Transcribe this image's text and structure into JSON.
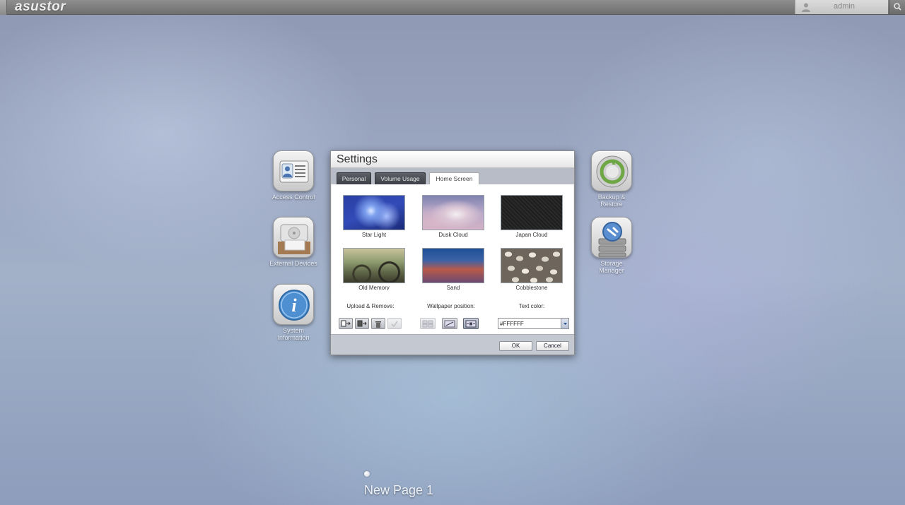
{
  "topbar": {
    "brand": "asustor",
    "username": "admin"
  },
  "desktop": {
    "left_apps": [
      {
        "label": "Access Control"
      },
      {
        "label": "External Devices"
      },
      {
        "label": "System Information"
      }
    ],
    "right_apps": [
      {
        "label": "Backup & Restore"
      },
      {
        "label": "Storage Manager"
      }
    ],
    "page_label": "New Page 1"
  },
  "dialog": {
    "title": "Settings",
    "tabs": [
      {
        "label": "Personal"
      },
      {
        "label": "Volume Usage"
      },
      {
        "label": "Home Screen"
      }
    ],
    "active_tab": "Home Screen",
    "wallpapers": [
      {
        "label": "Star Light"
      },
      {
        "label": "Dusk Cloud"
      },
      {
        "label": "Japan Cloud"
      },
      {
        "label": "Old Memory"
      },
      {
        "label": "Sand"
      },
      {
        "label": "Cobblestone"
      }
    ],
    "options": {
      "upload_label": "Upload & Remove:",
      "position_label": "Wallpaper position:",
      "color_label": "Text color:",
      "text_color_value": "#FFFFFF"
    },
    "buttons": {
      "ok": "OK",
      "cancel": "Cancel"
    }
  }
}
